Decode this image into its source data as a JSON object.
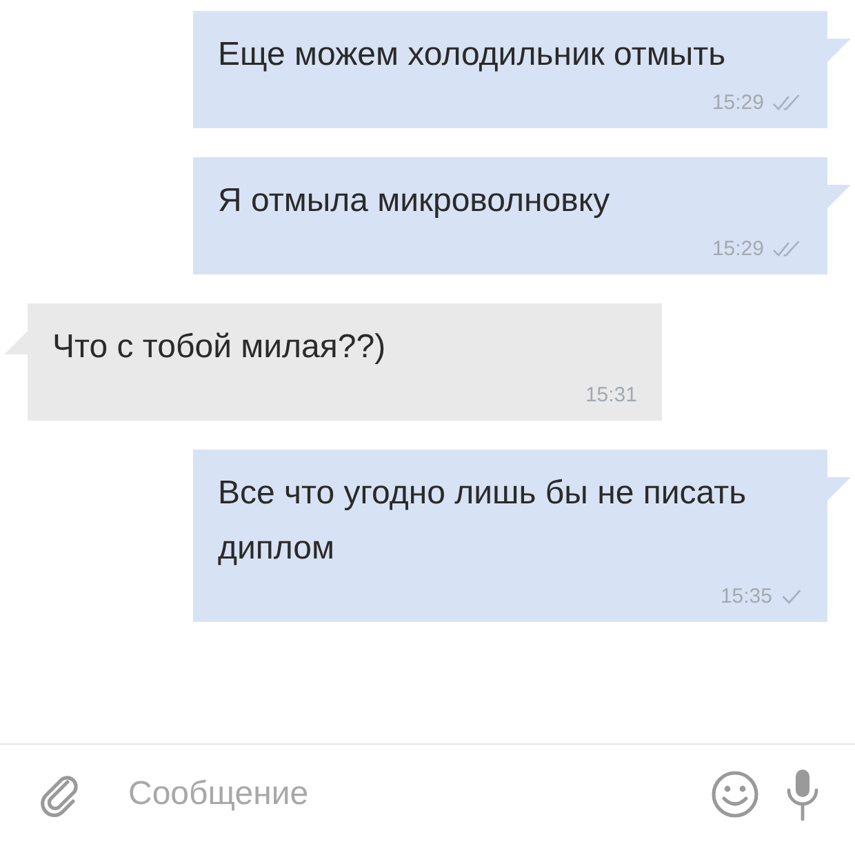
{
  "messages": [
    {
      "kind": "outgoing",
      "text": "Еще можем холодильник отмыть",
      "time": "15:29",
      "read": true
    },
    {
      "kind": "outgoing",
      "text": "Я отмыла микроволновку",
      "time": "15:29",
      "read": true
    },
    {
      "kind": "incoming",
      "text": "Что с тобой милая??)",
      "time": "15:31"
    },
    {
      "kind": "outgoing",
      "text": "Все что угодно лишь бы не писать диплом",
      "time": "15:35",
      "read": false
    }
  ],
  "composer": {
    "placeholder": "Сообщение"
  }
}
